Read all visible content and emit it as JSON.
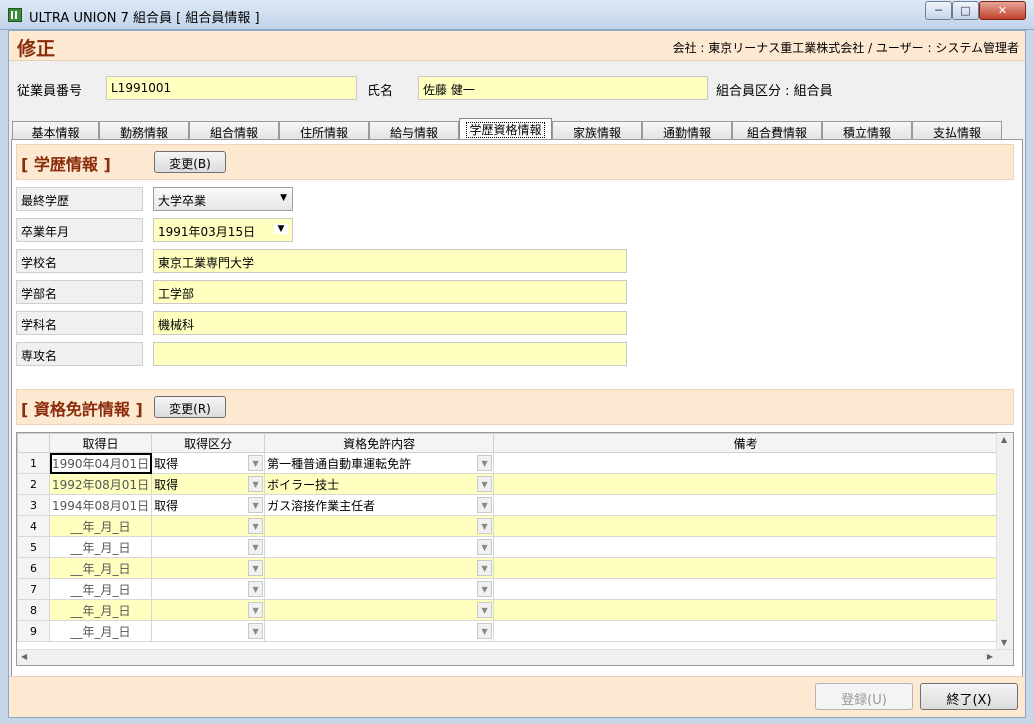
{
  "window": {
    "title": "ULTRA UNION 7 組合員 [ 組合員情報 ]"
  },
  "header": {
    "mode": "修正",
    "company_info": "会社 : 東京リーナス重工業株式会社 / ユーザー : システム管理者"
  },
  "employee": {
    "id_label": "従業員番号",
    "id_value": "L1991001",
    "name_label": "氏名",
    "name_value": "佐藤 健一",
    "category": "組合員区分 : 組合員"
  },
  "tabs": [
    {
      "label": "基本情報"
    },
    {
      "label": "勤務情報"
    },
    {
      "label": "組合情報"
    },
    {
      "label": "住所情報"
    },
    {
      "label": "給与情報"
    },
    {
      "label": "学歴資格情報"
    },
    {
      "label": "家族情報"
    },
    {
      "label": "通勤情報"
    },
    {
      "label": "組合費情報"
    },
    {
      "label": "積立情報"
    },
    {
      "label": "支払情報"
    }
  ],
  "education": {
    "title": "[ 学歴情報 ]",
    "change_button": "変更(B)",
    "final_education_label": "最終学歴",
    "final_education_value": "大学卒業",
    "graduation_label": "卒業年月",
    "graduation_value": "1991年03月15日",
    "school_label": "学校名",
    "school_value": "東京工業専門大学",
    "faculty_label": "学部名",
    "faculty_value": "工学部",
    "department_label": "学科名",
    "department_value": "機械科",
    "major_label": "専攻名",
    "major_value": ""
  },
  "qualifications": {
    "title": "[ 資格免許情報 ]",
    "change_button": "変更(R)",
    "columns": [
      "取得日",
      "取得区分",
      "資格免許内容",
      "備考"
    ],
    "rows": [
      {
        "no": "1",
        "date": "1990年04月01日",
        "type": "取得",
        "content": "第一種普通自動車運転免許",
        "note": ""
      },
      {
        "no": "2",
        "date": "1992年08月01日",
        "type": "取得",
        "content": "ボイラー技士",
        "note": ""
      },
      {
        "no": "3",
        "date": "1994年08月01日",
        "type": "取得",
        "content": "ガス溶接作業主任者",
        "note": ""
      },
      {
        "no": "4",
        "date": "__年_月_日",
        "type": "",
        "content": "",
        "note": ""
      },
      {
        "no": "5",
        "date": "__年_月_日",
        "type": "",
        "content": "",
        "note": ""
      },
      {
        "no": "6",
        "date": "__年_月_日",
        "type": "",
        "content": "",
        "note": ""
      },
      {
        "no": "7",
        "date": "__年_月_日",
        "type": "",
        "content": "",
        "note": ""
      },
      {
        "no": "8",
        "date": "__年_月_日",
        "type": "",
        "content": "",
        "note": ""
      },
      {
        "no": "9",
        "date": "__年_月_日",
        "type": "",
        "content": "",
        "note": ""
      }
    ]
  },
  "footer": {
    "register_button": "登録(U)",
    "exit_button": "終了(X)"
  }
}
